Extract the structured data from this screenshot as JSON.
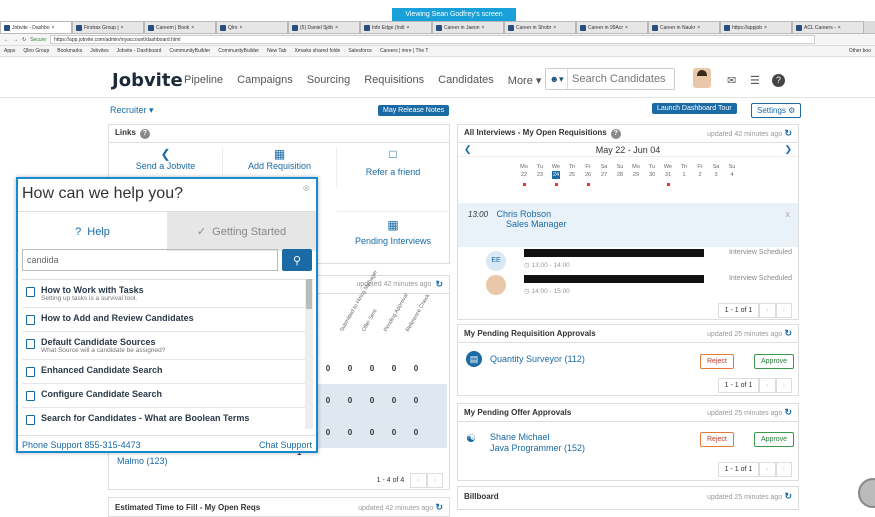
{
  "banner": "Viewing Sean Godfrey's screen",
  "browser": {
    "tabs": [
      "Jobvite - Dashbo",
      "Firstrax Group |",
      "Careem | Book",
      "Qlro",
      "(5) Daniel Sjöb",
      "Info Edge (Indi",
      "Career in Jaeon",
      "Career in Shobr",
      "Career in 99Acr",
      "Career in Naukr",
      "https://appjob",
      "ACL Careers -"
    ],
    "secure": "Secure",
    "url": "https://app.jobvite.com/admin/myaccount/dashboard.html",
    "bookmarks": [
      "Apps",
      "Qliro Group",
      "Bookmarks",
      "Jobvites",
      "Jobvite - Dashboard",
      "CommunityBuilder",
      "CommunityBuilder",
      "New Tab",
      "Xmarks shared folde",
      "Salesforce",
      "Careers | imre | The T"
    ],
    "other_bookmarks": "Other boo"
  },
  "nav": {
    "logo": "Jobvite",
    "items": [
      "Pipeline",
      "Campaigns",
      "Sourcing",
      "Requisitions",
      "Candidates",
      "More"
    ],
    "search_placeholder": "Search Candidates"
  },
  "subbar": {
    "recruiter": "Recruiter",
    "release_notes": "May Release Notes",
    "launch_tour": "Launch Dashboard Tour",
    "settings": "Settings"
  },
  "links_panel": {
    "title": "Links",
    "items": [
      "Send a Jobvite",
      "Add Requisition",
      "Refer a friend",
      "Pending Interviews"
    ]
  },
  "modal": {
    "title": "How can we help you?",
    "tab_help": "Help",
    "tab_getting_started": "Getting Started",
    "search_value": "candida",
    "items": [
      {
        "title": "How to Work with Tasks",
        "sub": "Setting up tasks is a survival tool."
      },
      {
        "title": "How to Add and Review Candidates",
        "sub": ""
      },
      {
        "title": "Default Candidate Sources",
        "sub": "What Source will a candidate be assigned?"
      },
      {
        "title": "Enhanced Candidate Search",
        "sub": ""
      },
      {
        "title": "Configure Candidate Search",
        "sub": ""
      },
      {
        "title": "Search for Candidates - What are Boolean Terms",
        "sub": ""
      }
    ],
    "phone": "Phone Support 855-315-4473",
    "chat": "Chat Support"
  },
  "pipeline_table": {
    "updated": "updated 42 minutes ago",
    "headers": [
      "Submitted to Hiring Manager",
      "Offer Sent",
      "Pending Approval",
      "Reference Check"
    ],
    "rows": [
      [
        "0",
        "0",
        "0",
        "0",
        "0"
      ],
      [
        "0",
        "0",
        "0",
        "0",
        "0"
      ],
      [
        "0",
        "0",
        "0",
        "0",
        "0"
      ]
    ],
    "last_row_label": "Malmo (123)",
    "last_row_first": "1",
    "pager": "1 - 4 of 4"
  },
  "time_to_fill": {
    "title": "Estimated Time to Fill - My Open Reqs",
    "updated": "updated 42 minutes ago"
  },
  "interviews": {
    "title": "All Interviews - My Open Requisitions",
    "updated": "updated 42 minutes ago",
    "range": "May 22 - Jun 04",
    "days": [
      {
        "d": "Mo",
        "n": "22"
      },
      {
        "d": "Tu",
        "n": "23"
      },
      {
        "d": "We",
        "n": "24"
      },
      {
        "d": "Th",
        "n": "25"
      },
      {
        "d": "Fr",
        "n": "26"
      },
      {
        "d": "Sa",
        "n": "27"
      },
      {
        "d": "Su",
        "n": "28"
      },
      {
        "d": "Mo",
        "n": "29"
      },
      {
        "d": "Tu",
        "n": "30"
      },
      {
        "d": "We",
        "n": "31"
      },
      {
        "d": "Th",
        "n": "1"
      },
      {
        "d": "Fr",
        "n": "2"
      },
      {
        "d": "Sa",
        "n": "3"
      },
      {
        "d": "Su",
        "n": "4"
      }
    ],
    "time": "13:00",
    "candidate": "Chris Robson",
    "role": "Sales Manager",
    "avatar_initials": "EE",
    "slot1_time": "13:00 - 14:00",
    "slot2_time": "14:00 - 15:00",
    "status1": "Interview Scheduled",
    "status2": "Interview Scheduled",
    "pager": "1 - 1 of 1"
  },
  "req_approvals": {
    "title": "My Pending Requisition Approvals",
    "updated": "updated 25 minutes ago",
    "item": "Quantity Surveyor (112)",
    "reject": "Reject",
    "approve": "Approve",
    "pager": "1 - 1 of 1"
  },
  "offer_approvals": {
    "title": "My Pending Offer Approvals",
    "updated": "updated 25 minutes ago",
    "name": "Shane Michael",
    "role": "Java Programmer (152)",
    "reject": "Reject",
    "approve": "Approve",
    "pager": "1 - 1 of 1"
  },
  "billboard": {
    "title": "Billboard",
    "updated": "updated 25 minutes ago"
  },
  "colors": {
    "accent": "#1a6aa5",
    "banner": "#1aa0d8"
  }
}
